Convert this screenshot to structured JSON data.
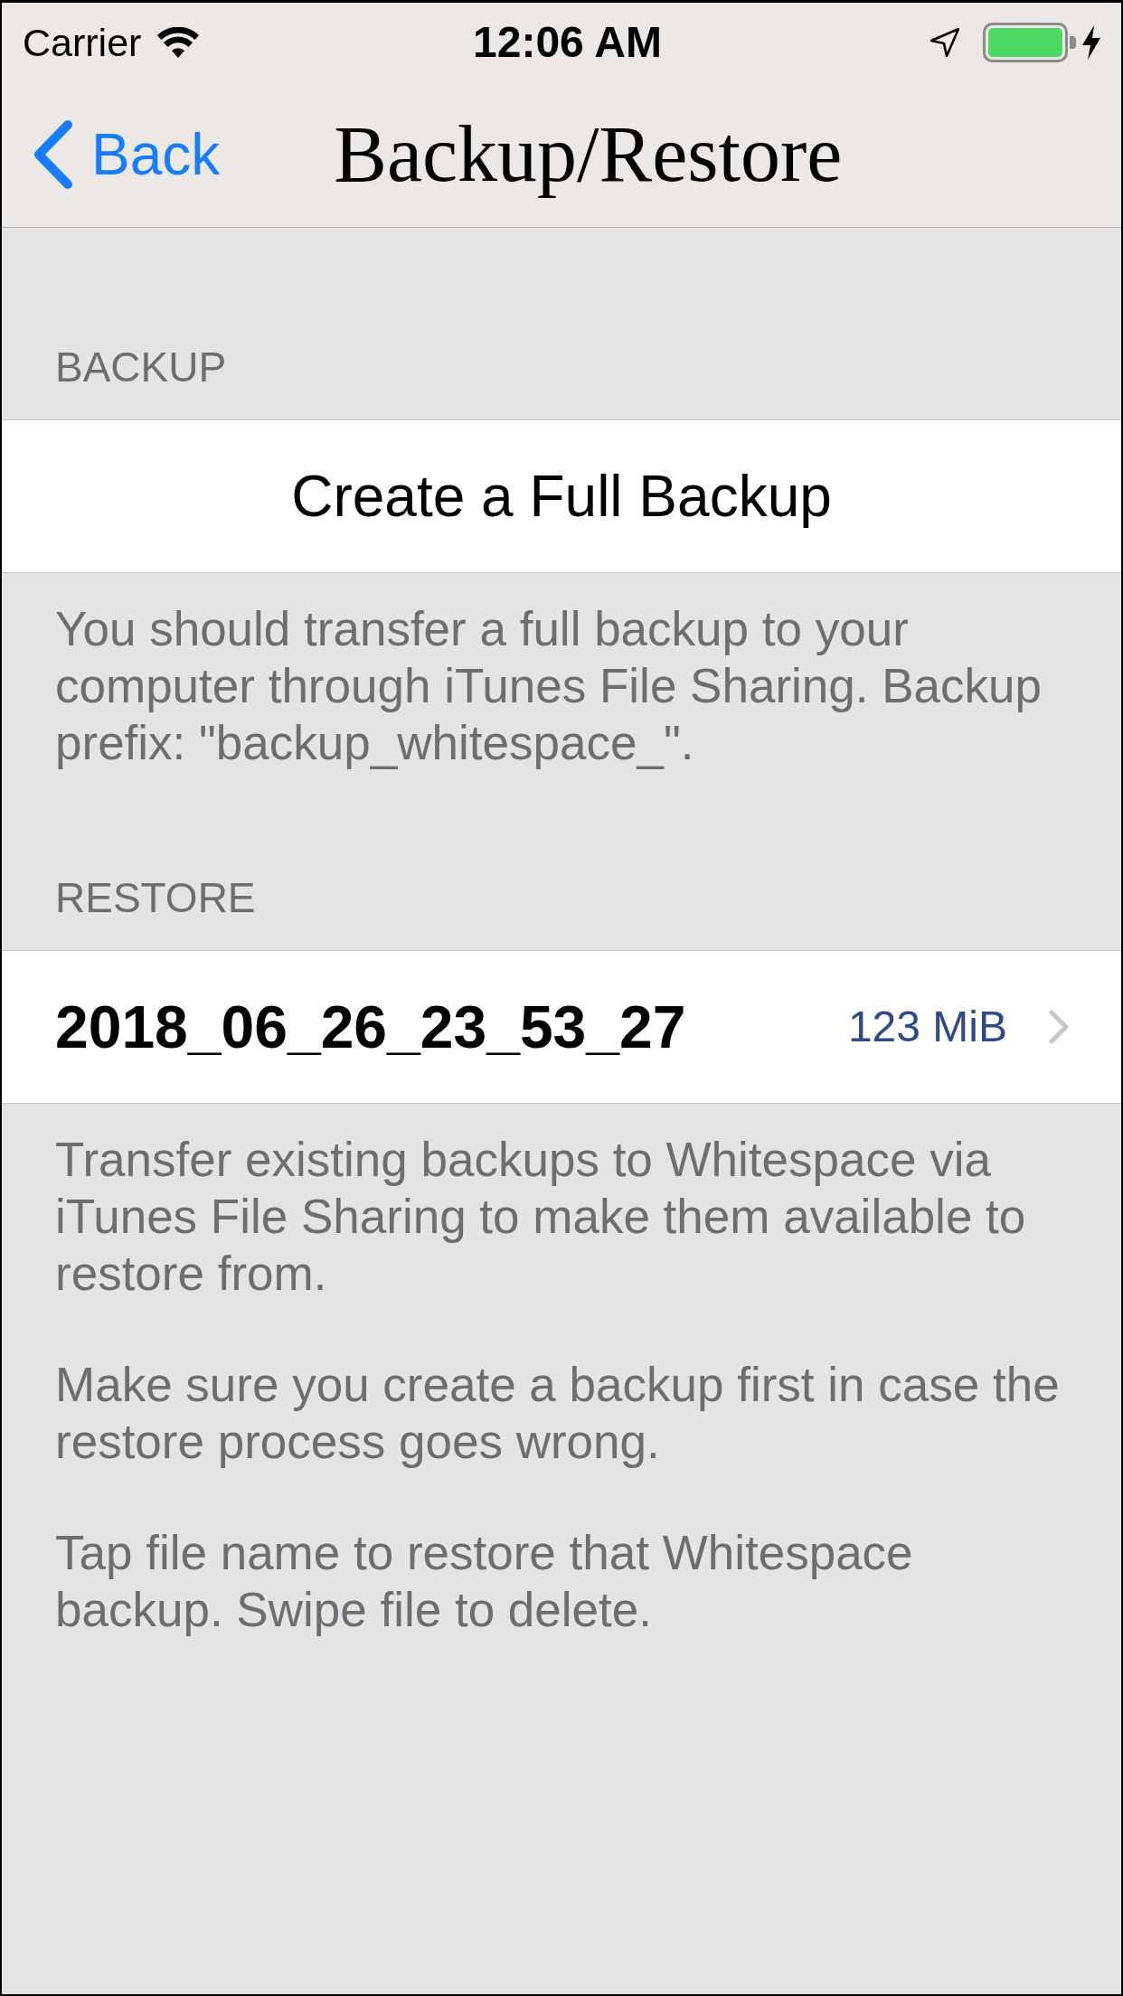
{
  "status_bar": {
    "carrier": "Carrier",
    "time": "12:06 AM"
  },
  "nav_bar": {
    "back_label": "Back",
    "title": "Backup/Restore"
  },
  "sections": [
    {
      "header": "BACKUP",
      "rows": [
        {
          "kind": "action",
          "label": "Create a Full Backup"
        }
      ],
      "footer": [
        "You should transfer a full backup to your computer through iTunes File Sharing. Backup prefix: \"backup_whitespace_\"."
      ]
    },
    {
      "header": "RESTORE",
      "rows": [
        {
          "kind": "file",
          "label": "2018_06_26_23_53_27",
          "detail": "123 MiB"
        }
      ],
      "footer": [
        "Transfer existing backups to Whitespace via iTunes File Sharing to make them available to restore from.",
        "Make sure you create a backup first in case the restore process goes wrong.",
        "Tap file name to restore that Whitespace backup. Swipe file to delete."
      ]
    }
  ]
}
